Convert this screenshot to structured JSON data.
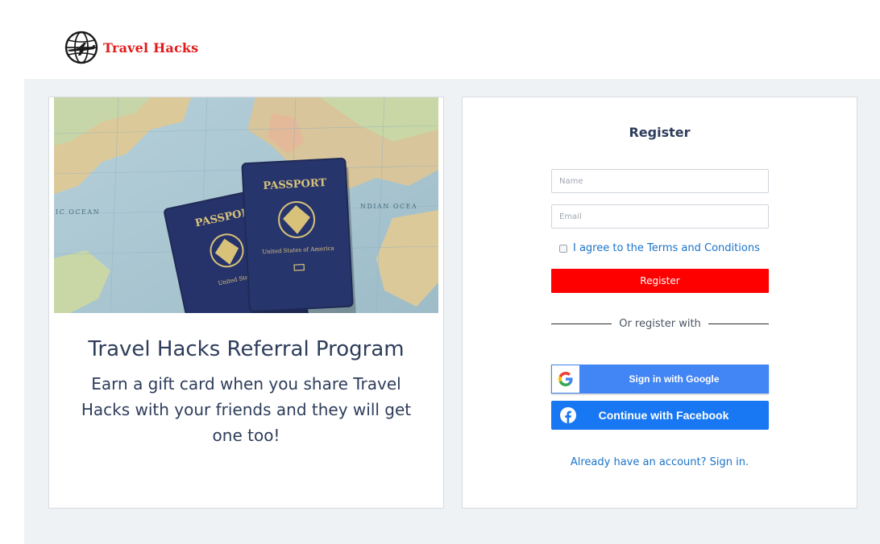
{
  "header": {
    "brand": "Travel Hacks",
    "logo_icon": "globe-airplane-icon"
  },
  "promo": {
    "image_alt": "Passports on a world map",
    "hero_passport_back": "PASSPORT",
    "hero_passport_front": "PASSPORT",
    "hero_country_front": "United States of America",
    "hero_country_back": "United Sta of Amer",
    "hero_map_ocean_left": "IC OCEAN",
    "hero_map_ocean_right": "NDIAN OCEA",
    "title": "Travel Hacks Referral Program",
    "description": "Earn a gift card when you share Travel Hacks with your friends and they will get one too!"
  },
  "register": {
    "title": "Register",
    "name_placeholder": "Name",
    "email_placeholder": "Email",
    "terms_label": "I agree to the Terms and Conditions",
    "register_button": "Register",
    "divider_text": "Or register with",
    "google_button": "Sign in with Google",
    "facebook_button": "Continue with Facebook",
    "signin_link": "Already have an account? Sign in."
  },
  "colors": {
    "brand_red": "#e01b1b",
    "register_button": "#ff0000",
    "google_blue": "#4285f4",
    "facebook_blue": "#1877f2",
    "link_blue": "#1a73c8",
    "page_bg": "#eff2f5",
    "text_dark": "#2e3d5b"
  }
}
